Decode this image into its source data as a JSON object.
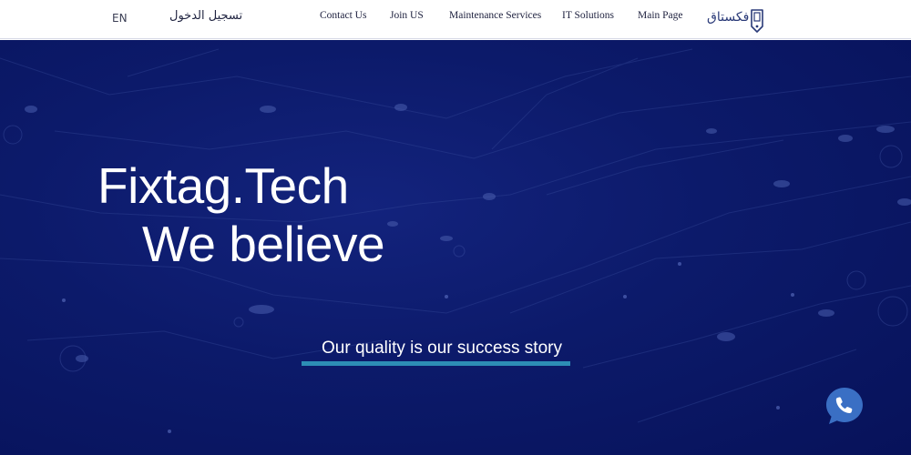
{
  "header": {
    "language_label": "EN",
    "login_label": "تسجيل الدخول",
    "nav": [
      {
        "label": "Contact Us"
      },
      {
        "label": "Join US"
      },
      {
        "label": "Maintenance Services"
      },
      {
        "label": "IT Solutions"
      },
      {
        "label": "Main Page"
      }
    ],
    "logo_text": "فكستاق"
  },
  "hero": {
    "headline_line1": "Fixtag.Tech",
    "headline_line2": "We believe",
    "tagline": "Our quality is our success story"
  },
  "icons": {
    "logo": "phone-tag-icon",
    "contact": "phone-chat-icon"
  },
  "colors": {
    "hero_background": "#0c1a6a",
    "accent_bar": "#2d8db5",
    "logo": "#2a3a78",
    "phone_button": "#3a6fc4"
  }
}
